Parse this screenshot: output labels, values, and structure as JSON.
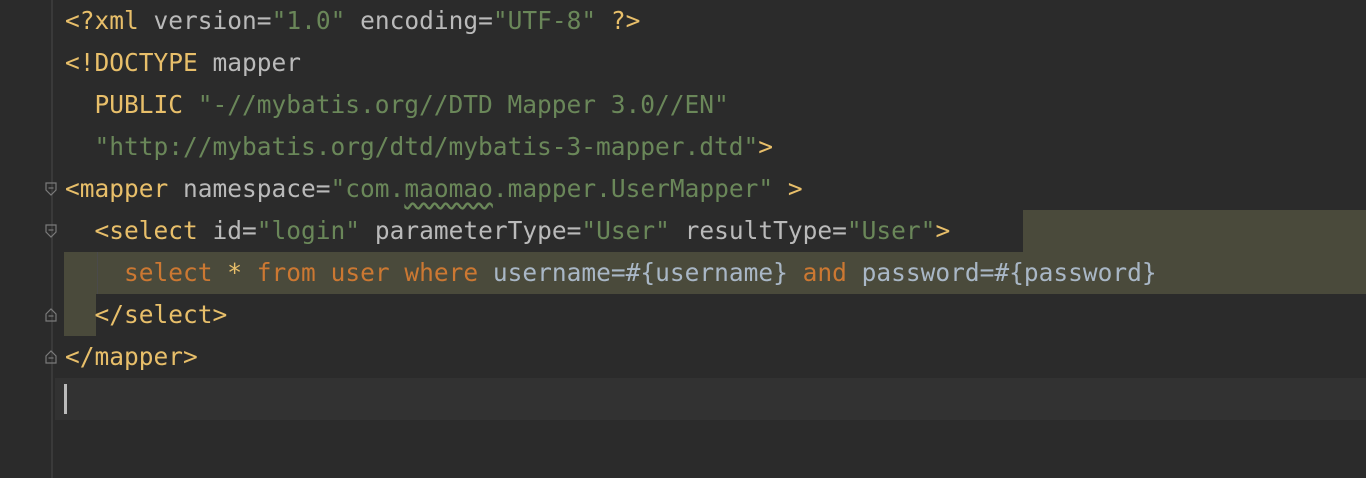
{
  "editor": {
    "lines": [
      {
        "tokens": [
          {
            "t": "<?",
            "c": "tag"
          },
          {
            "t": "xml ",
            "c": "tag"
          },
          {
            "t": "version",
            "c": "attr"
          },
          {
            "t": "=",
            "c": "attr"
          },
          {
            "t": "\"1.0\"",
            "c": "str"
          },
          {
            "t": " ",
            "c": "plain"
          },
          {
            "t": "encoding",
            "c": "attr"
          },
          {
            "t": "=",
            "c": "attr"
          },
          {
            "t": "\"UTF-8\"",
            "c": "str"
          },
          {
            "t": " ?>",
            "c": "tag"
          }
        ]
      },
      {
        "tokens": [
          {
            "t": "<!DOCTYPE ",
            "c": "tag"
          },
          {
            "t": "mapper",
            "c": "attr"
          }
        ]
      },
      {
        "tokens": [
          {
            "t": "  PUBLIC ",
            "c": "tag"
          },
          {
            "t": "\"-//mybatis.org//DTD Mapper 3.0//EN\"",
            "c": "str"
          }
        ]
      },
      {
        "tokens": [
          {
            "t": "  \"http://mybatis.org/dtd/mybatis-3-mapper.dtd\"",
            "c": "str"
          },
          {
            "t": ">",
            "c": "tag"
          }
        ]
      },
      {
        "tokens": [
          {
            "t": "<mapper ",
            "c": "tag"
          },
          {
            "t": "namespace",
            "c": "attr"
          },
          {
            "t": "=",
            "c": "attr"
          },
          {
            "t": "\"com.",
            "c": "str"
          },
          {
            "t": "maomao",
            "c": "str typo"
          },
          {
            "t": ".mapper.UserMapper\"",
            "c": "str"
          },
          {
            "t": " >",
            "c": "tag"
          }
        ]
      },
      {
        "tokens": [
          {
            "t": "  <select ",
            "c": "tag"
          },
          {
            "t": "id",
            "c": "attr"
          },
          {
            "t": "=",
            "c": "attr"
          },
          {
            "t": "\"login\"",
            "c": "str"
          },
          {
            "t": " ",
            "c": "plain"
          },
          {
            "t": "parameterType",
            "c": "attr"
          },
          {
            "t": "=",
            "c": "attr"
          },
          {
            "t": "\"User\"",
            "c": "str"
          },
          {
            "t": " ",
            "c": "plain"
          },
          {
            "t": "resultType",
            "c": "attr"
          },
          {
            "t": "=",
            "c": "attr"
          },
          {
            "t": "\"User\"",
            "c": "str"
          },
          {
            "t": ">",
            "c": "tag"
          }
        ]
      },
      {
        "tokens": [
          {
            "t": "    select",
            "c": "kw"
          },
          {
            "t": " * ",
            "c": "tag"
          },
          {
            "t": "from",
            "c": "kw"
          },
          {
            "t": " ",
            "c": "plain"
          },
          {
            "t": "user",
            "c": "kw"
          },
          {
            "t": " ",
            "c": "plain"
          },
          {
            "t": "where",
            "c": "kw"
          },
          {
            "t": " username=#{username} ",
            "c": "sqlvar"
          },
          {
            "t": "and",
            "c": "kw"
          },
          {
            "t": " password=#{password}",
            "c": "sqlvar"
          }
        ]
      },
      {
        "tokens": [
          {
            "t": "  </select>",
            "c": "tag"
          }
        ]
      },
      {
        "tokens": [
          {
            "t": "</mapper>",
            "c": "tag"
          }
        ]
      },
      {
        "tokens": []
      }
    ]
  }
}
